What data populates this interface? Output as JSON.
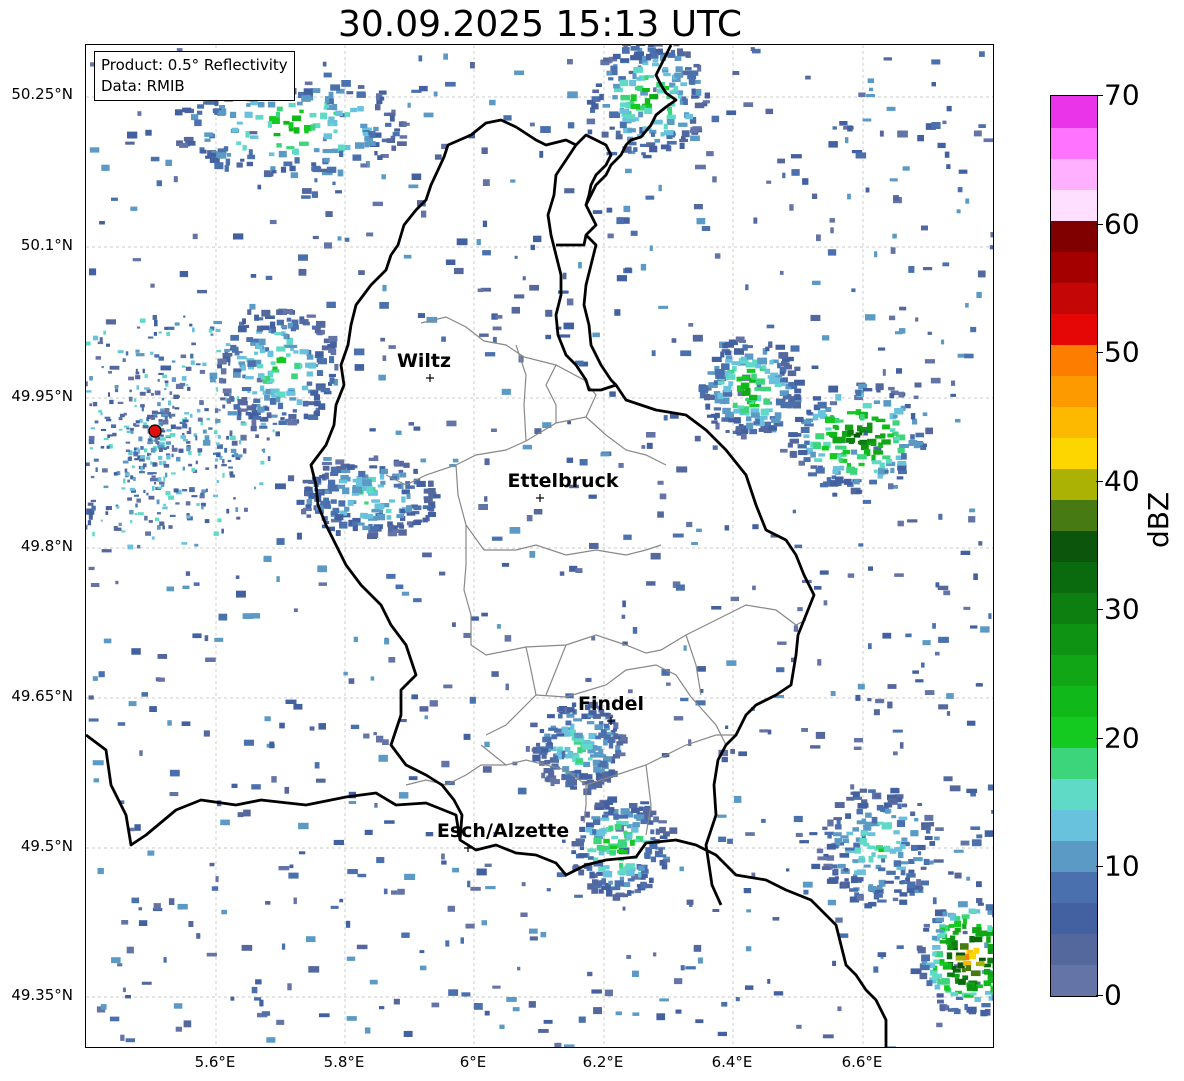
{
  "title": "30.09.2025 15:13 UTC",
  "info_box": {
    "product": "Product: 0.5° Reflectivity",
    "data": "Data: RMIB"
  },
  "axes": {
    "lat_ticks": [
      "50.25°N",
      "50.1°N",
      "49.95°N",
      "49.8°N",
      "49.65°N",
      "49.5°N",
      "49.35°N"
    ],
    "lon_ticks": [
      "5.6°E",
      "5.8°E",
      "6°E",
      "6.2°E",
      "6.4°E",
      "6.6°E"
    ]
  },
  "cities": [
    {
      "name": "Wiltz"
    },
    {
      "name": "Ettelbruck"
    },
    {
      "name": "Findel"
    },
    {
      "name": "Esch/Alzette"
    }
  ],
  "colorbar": {
    "label": "dBZ",
    "min": 0,
    "max": 70,
    "ticks": [
      "0",
      "10",
      "20",
      "30",
      "40",
      "50",
      "60",
      "70"
    ],
    "colors": [
      "#6474a6",
      "#55689e",
      "#4360a0",
      "#4a70ae",
      "#5b9ac4",
      "#69c2dd",
      "#5fdac6",
      "#3dd57b",
      "#14c91f",
      "#10b81a",
      "#10a615",
      "#0e9412",
      "#0c7f10",
      "#0a6b0e",
      "#0b560c",
      "#477a12",
      "#acb203",
      "#fdd600",
      "#fdb800",
      "#fd9a00",
      "#fd7d00",
      "#e50606",
      "#c40606",
      "#a40000",
      "#800000",
      "#ffdfff",
      "#ffb1ff",
      "#ff73ff",
      "#ea34ea"
    ]
  },
  "radar_site_color": "#e01010"
}
